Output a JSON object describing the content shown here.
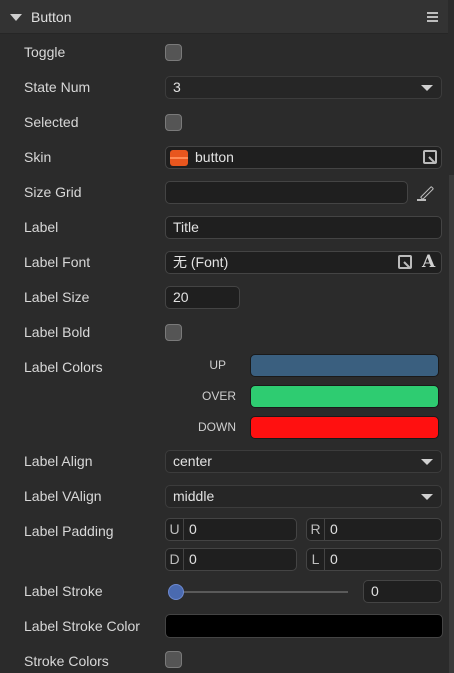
{
  "header": {
    "title": "Button"
  },
  "rows": {
    "toggle": "Toggle",
    "state_num": "State Num",
    "selected": "Selected",
    "skin": "Skin",
    "size_grid": "Size Grid",
    "label": "Label",
    "label_font": "Label Font",
    "label_size": "Label Size",
    "label_bold": "Label Bold",
    "label_colors": "Label Colors",
    "label_align": "Label Align",
    "label_valign": "Label VAlign",
    "label_padding": "Label Padding",
    "label_stroke": "Label Stroke",
    "label_stroke_color": "Label Stroke Color",
    "stroke_colors": "Stroke Colors"
  },
  "values": {
    "toggle_checked": false,
    "state_num": "3",
    "selected_checked": false,
    "skin": "button",
    "size_grid": "",
    "label": "Title",
    "label_font": "无 (Font)",
    "label_size": "20",
    "label_bold_checked": false,
    "label_align": "center",
    "label_valign": "middle",
    "label_stroke": "0",
    "label_stroke_fraction": 0,
    "stroke_colors_checked": false
  },
  "label_colors": [
    {
      "name": "UP",
      "color": "#3a5f7f"
    },
    {
      "name": "OVER",
      "color": "#2ecc71"
    },
    {
      "name": "DOWN",
      "color": "#ff1010"
    }
  ],
  "padding": [
    {
      "letter": "U",
      "value": "0"
    },
    {
      "letter": "R",
      "value": "0"
    },
    {
      "letter": "D",
      "value": "0"
    },
    {
      "letter": "L",
      "value": "0"
    }
  ],
  "label_stroke_color": "#000000",
  "icons": {
    "header_caret": "caret-down-icon",
    "header_menu": "hamburger-menu-icon",
    "skin_asset": "image-asset-icon",
    "picker": "resource-picker-icon",
    "edit": "pencil-edit-icon",
    "font": "font-A-icon",
    "dropdown": "chevron-down-icon"
  }
}
